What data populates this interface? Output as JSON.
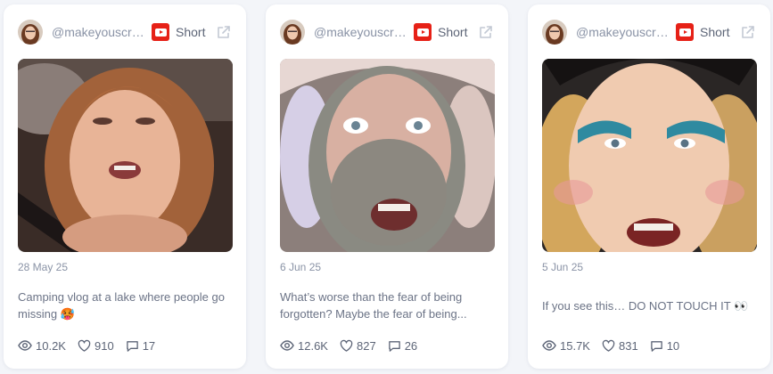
{
  "cards": [
    {
      "handle": "@makeyouscre...",
      "platform_icon": "youtube-icon",
      "type_label": "Short",
      "date": "28 May 25",
      "title": "Camping vlog at a lake where people go missing 🥵",
      "views": "10.2K",
      "likes": "910",
      "comments": "17"
    },
    {
      "handle": "@makeyouscre...",
      "platform_icon": "youtube-icon",
      "type_label": "Short",
      "date": "6 Jun 25",
      "title": "What’s worse than the fear of being forgotten? Maybe the fear of being...",
      "views": "12.6K",
      "likes": "827",
      "comments": "26"
    },
    {
      "handle": "@makeyouscre...",
      "platform_icon": "youtube-icon",
      "type_label": "Short",
      "date": "5 Jun 25",
      "title": "If you see this… DO NOT TOUCH IT 👀",
      "views": "15.7K",
      "likes": "831",
      "comments": "10"
    }
  ],
  "colors": {
    "youtube_red": "#e62117",
    "card_bg": "#ffffff",
    "page_bg": "#f3f5f9",
    "muted_text": "#8a93a6"
  }
}
